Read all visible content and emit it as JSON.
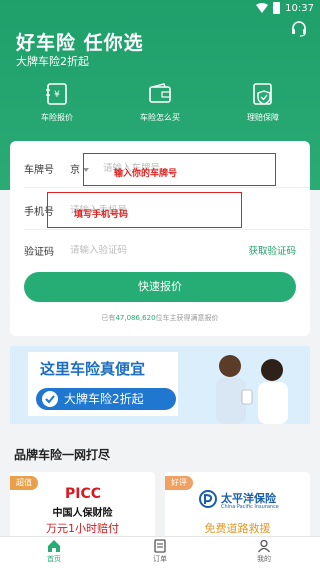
{
  "status": {
    "time": "10:37"
  },
  "header": {
    "title": "好车险 任你选",
    "subtitle": "大牌车险2折起"
  },
  "quick_actions": [
    {
      "label": "车险报价",
      "icon": "quote-doc-icon"
    },
    {
      "label": "车险怎么买",
      "icon": "wallet-icon"
    },
    {
      "label": "理赔保障",
      "icon": "shield-icon"
    }
  ],
  "form": {
    "plate_label": "车牌号",
    "plate_province": "京",
    "plate_placeholder": "请输入车牌号",
    "phone_label": "手机号",
    "phone_placeholder": "请输入手机号",
    "code_label": "验证码",
    "code_placeholder": "请输入验证码",
    "get_code": "获取验证码",
    "submit": "快速报价",
    "stat_prefix": "已有",
    "stat_number": "47,086,620",
    "stat_suffix": "位车主获得满意报价"
  },
  "annotations": {
    "plate_hint": "输入你的车牌号",
    "phone_hint": "填写手机号码"
  },
  "banner": {
    "title": "这里车险真便宜",
    "pill": "大牌车险2折起"
  },
  "brands_section": {
    "title": "品牌车险一网打尽",
    "cards": [
      {
        "tag": "超值",
        "logo_main": "PICC",
        "logo_sub": "中国人保财险",
        "slogan": "万元1小时赔付"
      },
      {
        "tag": "好评",
        "logo_main": "太平洋保险",
        "logo_sub": "China Pacific Insurance",
        "slogan": "免费道路救援"
      }
    ]
  },
  "tabbar": [
    {
      "label": "首页",
      "icon": "home-icon",
      "active": true
    },
    {
      "label": "订单",
      "icon": "order-icon",
      "active": false
    },
    {
      "label": "我的",
      "icon": "user-icon",
      "active": false
    }
  ],
  "colors": {
    "brand_green": "#26ad76",
    "annotation_red": "#dd2222",
    "banner_blue": "#1e6fc1"
  }
}
